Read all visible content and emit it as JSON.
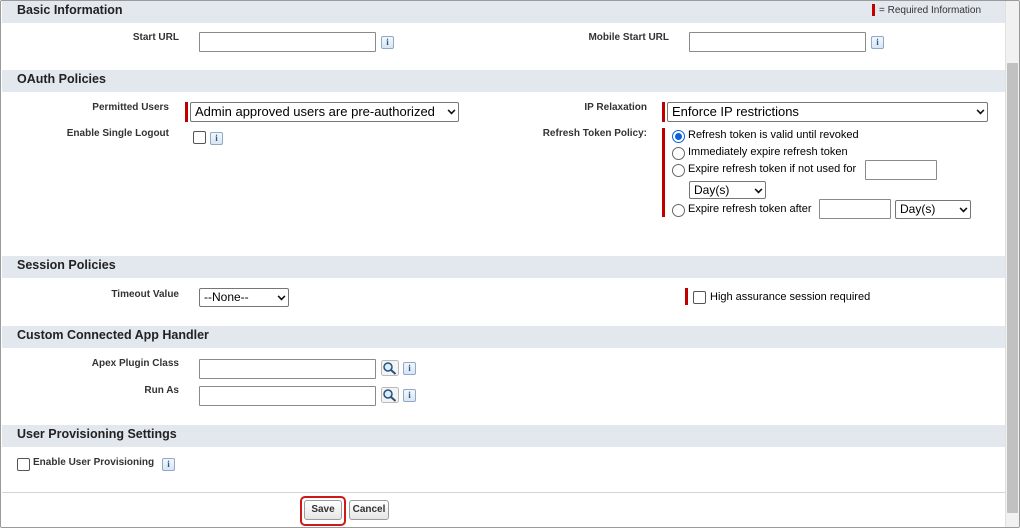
{
  "basic_info": {
    "title": "Basic Information",
    "required_legend": "= Required Information",
    "start_url_label": "Start URL",
    "start_url_value": "",
    "mobile_start_url_label": "Mobile Start URL",
    "mobile_start_url_value": ""
  },
  "oauth": {
    "title": "OAuth Policies",
    "permitted_users_label": "Permitted Users",
    "permitted_users_value": "Admin approved users are pre-authorized",
    "ip_relaxation_label": "IP Relaxation",
    "ip_relaxation_value": "Enforce IP restrictions",
    "single_logout_label": "Enable Single Logout",
    "refresh_policy_label": "Refresh Token Policy:",
    "refresh_options": [
      "Refresh token is valid until revoked",
      "Immediately expire refresh token",
      "Expire refresh token if not used for",
      "Expire refresh token after"
    ],
    "selected_option": 0,
    "unused_unit": "Day(s)",
    "after_unit": "Day(s)"
  },
  "session": {
    "title": "Session Policies",
    "timeout_label": "Timeout Value",
    "timeout_value": "--None--",
    "high_assurance_label": "High assurance session required"
  },
  "handler": {
    "title": "Custom Connected App Handler",
    "apex_label": "Apex Plugin Class",
    "run_as_label": "Run As"
  },
  "provisioning": {
    "title": "User Provisioning Settings",
    "enable_label": "Enable User Provisioning"
  },
  "buttons": {
    "save": "Save",
    "cancel": "Cancel"
  },
  "icons": {
    "info": "info-icon",
    "lookup": "lookup-magnifier-icon"
  },
  "colors": {
    "section_bg": "#e3e7ee",
    "required": "#c00000",
    "radio_accent": "#0a63d8",
    "focus": "#d01818"
  }
}
